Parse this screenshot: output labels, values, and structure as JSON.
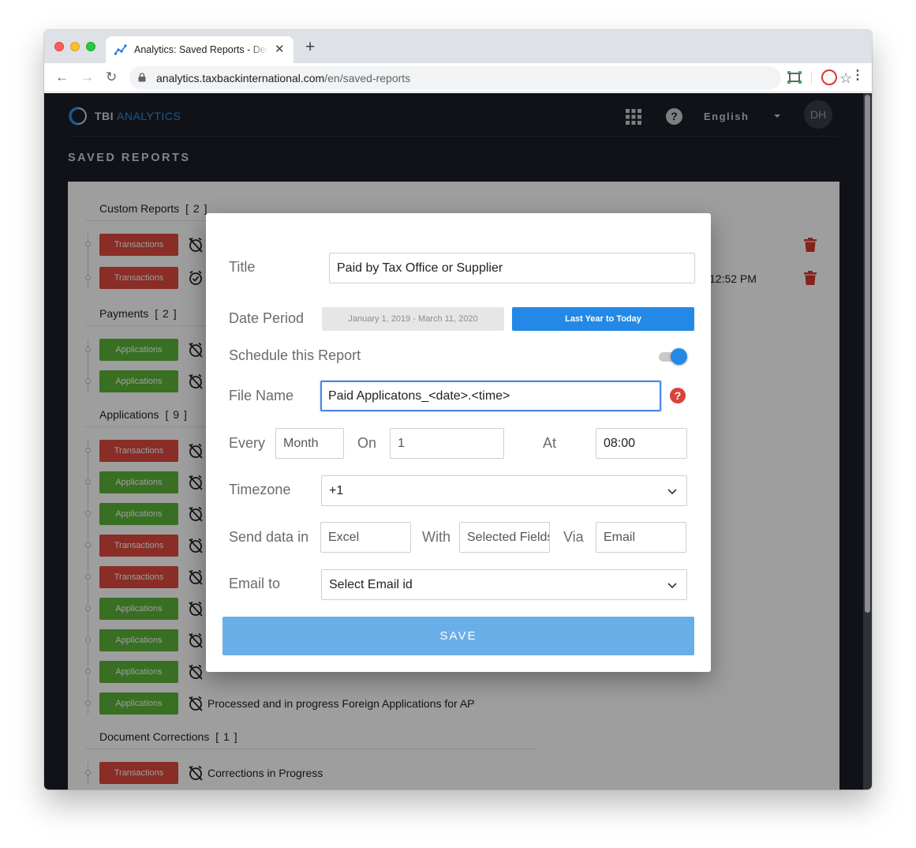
{
  "browser": {
    "tab_title": "Analytics: Saved Reports - Demo",
    "url_host": "analytics.taxbackinternational.com",
    "url_path": "/en/saved-reports"
  },
  "header": {
    "brand_tbi": "TBI",
    "brand_analytics": "ANALYTICS",
    "language": "English",
    "avatar_initials": "DH",
    "help_glyph": "?"
  },
  "page_title": "SAVED REPORTS",
  "sections": [
    {
      "title": "Custom Reports",
      "count": "[ 2 ]",
      "rows": [
        {
          "badge": "Transactions",
          "color": "red",
          "icon": "alarm-off-icon",
          "text": "",
          "time": ""
        },
        {
          "badge": "Transactions",
          "color": "red",
          "icon": "alarm-check-icon",
          "text": "",
          "time": "12:52 PM"
        }
      ]
    },
    {
      "title": "Payments",
      "count": "[ 2 ]",
      "rows": [
        {
          "badge": "Applications",
          "color": "green",
          "icon": "alarm-off-icon",
          "text": ""
        },
        {
          "badge": "Applications",
          "color": "green",
          "icon": "alarm-off-icon",
          "text": ""
        }
      ]
    },
    {
      "title": "Applications",
      "count": "[ 9 ]",
      "rows": [
        {
          "badge": "Transactions",
          "color": "red",
          "icon": "alarm-off-icon",
          "text": ""
        },
        {
          "badge": "Applications",
          "color": "green",
          "icon": "alarm-off-icon",
          "text": ""
        },
        {
          "badge": "Applications",
          "color": "green",
          "icon": "alarm-off-icon",
          "text": ""
        },
        {
          "badge": "Transactions",
          "color": "red",
          "icon": "alarm-off-icon",
          "text": ""
        },
        {
          "badge": "Transactions",
          "color": "red",
          "icon": "alarm-off-icon",
          "text": ""
        },
        {
          "badge": "Applications",
          "color": "green",
          "icon": "alarm-off-icon",
          "text": ""
        },
        {
          "badge": "Applications",
          "color": "green",
          "icon": "alarm-off-icon",
          "text": ""
        },
        {
          "badge": "Applications",
          "color": "green",
          "icon": "alarm-off-icon",
          "text": ""
        },
        {
          "badge": "Applications",
          "color": "green",
          "icon": "alarm-off-icon",
          "text": "Processed and in progress Foreign Applications for AP"
        }
      ]
    },
    {
      "title": "Document Corrections",
      "count": "[ 1 ]",
      "rows": [
        {
          "badge": "Transactions",
          "color": "red",
          "icon": "alarm-off-icon",
          "text": "Corrections in Progress"
        }
      ]
    }
  ],
  "modal": {
    "title_label": "Title",
    "title_value": "Paid by Tax Office or Supplier",
    "date_period_label": "Date Period",
    "date_range_option": "January 1, 2019 - March 11, 2020",
    "date_preset_option": "Last Year to Today",
    "schedule_label": "Schedule this Report",
    "schedule_enabled": true,
    "file_name_label": "File Name",
    "file_name_value": "Paid Applicatons_<date>.<time>",
    "help_glyph": "?",
    "every_label": "Every",
    "every_placeholder": "Month",
    "on_label": "On",
    "on_value": "1",
    "at_label": "At",
    "at_value": "08:00",
    "timezone_label": "Timezone",
    "timezone_value": "+1",
    "send_label": "Send data in",
    "send_placeholder": "Excel",
    "with_label": "With",
    "with_placeholder": "Selected Fields",
    "via_label": "Via",
    "via_placeholder": "Email",
    "email_label": "Email to",
    "email_value": "Select Email id",
    "save_label": "SAVE"
  },
  "colors": {
    "accent": "#2489e6",
    "badge_red": "#dd4a3e",
    "badge_green": "#5bb338",
    "app_background": "#1a1d27"
  }
}
